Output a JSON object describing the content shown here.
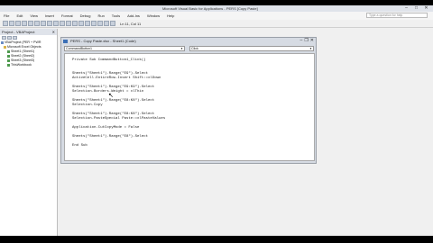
{
  "window": {
    "title": "Microsoft Visual Basic for Applications - PERS [Copy Paste]",
    "minimize": "–",
    "maximize": "□",
    "close": "✕"
  },
  "menu": [
    "File",
    "Edit",
    "View",
    "Insert",
    "Format",
    "Debug",
    "Run",
    "Tools",
    "Add-Ins",
    "Window",
    "Help"
  ],
  "help_box": "Type a question for help",
  "status": "Ln 11, Col 11",
  "project_panel": {
    "title": "Project - VBAProject",
    "close": "✕",
    "items": [
      "VBAProject (PER + PWR",
      "Microsoft Excel Objects",
      "Sheet1 (Sheet1)",
      "Sheet2 (Sheet2)",
      "Sheet3 (Sheet3)",
      "ThisWorkbook"
    ]
  },
  "code_window": {
    "title": "PERS - Copy Paste.xlsx - Sheet1 (Code)",
    "object_combo": "CommandButton1",
    "proc_combo": "Click",
    "minimize": "–",
    "restore": "❐",
    "close": "✕"
  },
  "code": [
    "Private Sub CommandButton1_Click()",
    "",
    "",
    "Sheets(\"Sheet1\").Range(\"E9\").Select",
    "ActiveCell.EntireRow.Insert Shift:=xlDown",
    "",
    "Sheets(\"Sheet1\").Range(\"E9:K9\").Select",
    "Selection.Borders.Weight = xlThin",
    "",
    "Sheets(\"Sheet1\").Range(\"E8:K8\").Select",
    "Selection.Copy",
    "",
    "Sheets(\"Sheet1\").Range(\"E8:K8\").Select",
    "Selection.PasteSpecial Paste:=xlPasteValues",
    "",
    "Application.CutCopyMode = False",
    "",
    "Sheets(\"Sheet1\").Range(\"E8\").Select",
    "",
    "End Sub"
  ]
}
